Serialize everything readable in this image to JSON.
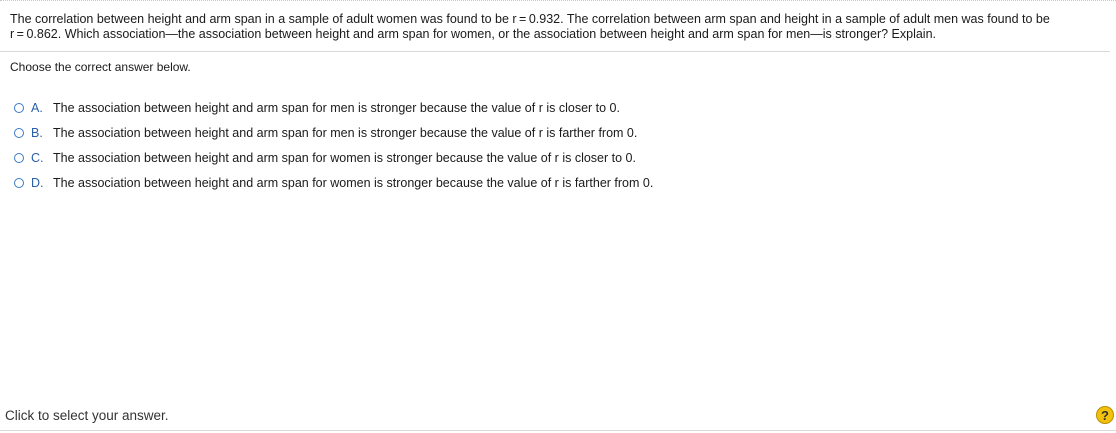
{
  "question": {
    "text_line1": "The correlation between height and arm span in a sample of adult women was found to be r = 0.932. The correlation between arm span and height in a sample of adult men was found to be",
    "text_line2": "r = 0.862. Which association—the association between height and arm span for women, or the association between height and arm span for men—is stronger? Explain."
  },
  "instruction": "Choose the correct answer below.",
  "options": [
    {
      "letter": "A.",
      "text": "The association between height and arm span for men is stronger because the value of r is closer to 0."
    },
    {
      "letter": "B.",
      "text": "The association between height and arm span for men is stronger because the value of r is farther from 0."
    },
    {
      "letter": "C.",
      "text": "The association between height and arm span for women is stronger because the value of r is closer to 0."
    },
    {
      "letter": "D.",
      "text": "The association between height and arm span for women is stronger because the value of r is farther from 0."
    }
  ],
  "footer": {
    "status": "Click to select your answer.",
    "help_icon": "?"
  },
  "colors": {
    "radio_border": "#3c7bc6",
    "option_letter": "#2a5fa8",
    "help_button": "#f2c10b"
  }
}
